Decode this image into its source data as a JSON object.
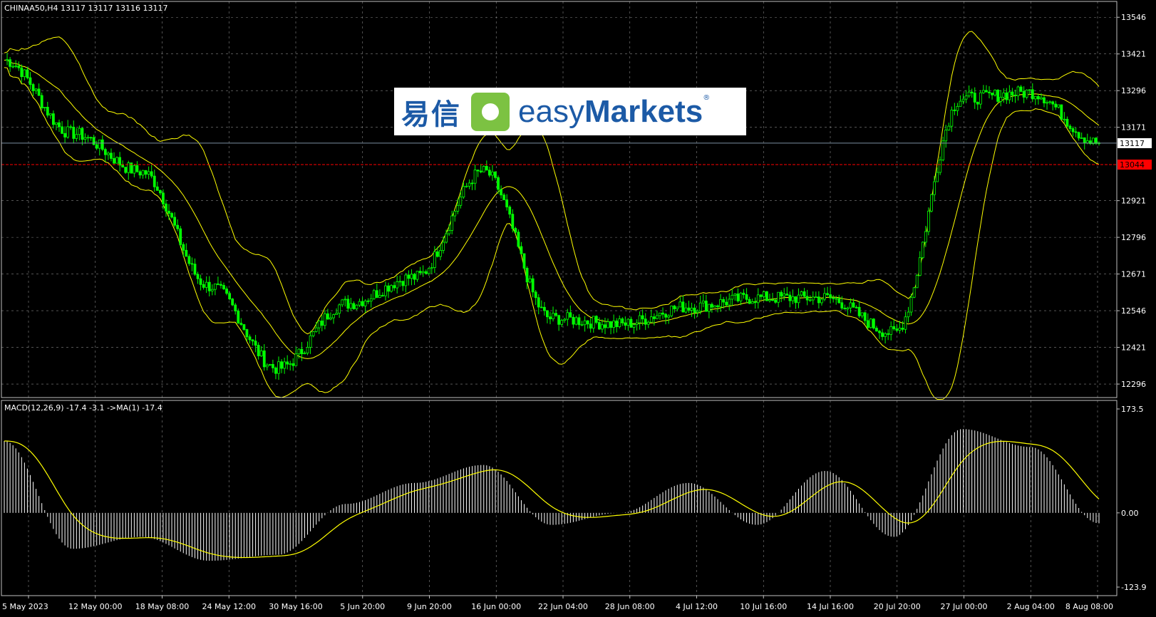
{
  "header": {
    "symbol_line": "CHINAA50,H4  13117 13117 13116 13117"
  },
  "macd_header": {
    "label": "MACD(12,26,9) -17.4 -3.1   ->MA(1) -17.4"
  },
  "watermark": {
    "cn": "易信",
    "en_light": "easy",
    "en_bold": "Markets",
    "reg": "®"
  },
  "price_axis": {
    "ticks": [
      "13546",
      "13421",
      "13296",
      "13171",
      "12921",
      "12796",
      "12671",
      "12546",
      "12421",
      "12296"
    ],
    "current_price": "13117",
    "red_line_price": "13044"
  },
  "macd_axis": {
    "ticks": [
      "173.5",
      "0.00",
      "-123.9"
    ]
  },
  "time_axis": {
    "labels": [
      "5 May 2023",
      "12 May 00:00",
      "18 May 08:00",
      "24 May 12:00",
      "30 May 16:00",
      "5 Jun 20:00",
      "9 Jun 20:00",
      "16 Jun 00:00",
      "22 Jun 04:00",
      "28 Jun 08:00",
      "4 Jul 12:00",
      "10 Jul 16:00",
      "14 Jul 16:00",
      "20 Jul 20:00",
      "27 Jul 00:00",
      "2 Aug 04:00",
      "8 Aug 08:00"
    ]
  },
  "colors": {
    "background": "#000000",
    "candles": "#00ff00",
    "bands": "#ffff00",
    "red_line": "#ff0000",
    "histogram": "#ffffff",
    "signal": "#ffff00",
    "grid": "#c0c0c0"
  },
  "chart_data": {
    "type": "line",
    "symbol": "CHINAA50",
    "timeframe": "H4",
    "indicators": [
      "Bollinger Bands",
      "MACD(12,26,9)"
    ],
    "x_labels": [
      "5 May 2023",
      "12 May 00:00",
      "18 May 08:00",
      "24 May 12:00",
      "30 May 16:00",
      "5 Jun 20:00",
      "9 Jun 20:00",
      "16 Jun 00:00",
      "22 Jun 04:00",
      "28 Jun 08:00",
      "4 Jul 12:00",
      "10 Jul 16:00",
      "14 Jul 16:00",
      "20 Jul 20:00",
      "27 Jul 00:00",
      "2 Aug 04:00",
      "8 Aug 08:00"
    ],
    "close_at_labels": [
      13400,
      13150,
      13020,
      12630,
      12350,
      12570,
      12660,
      13020,
      12520,
      12500,
      12560,
      12590,
      12590,
      12470,
      13270,
      13290,
      13117
    ],
    "price_ylim": [
      12250,
      13600
    ],
    "macd_at_labels": [
      120,
      -60,
      -40,
      -80,
      -70,
      15,
      50,
      80,
      -20,
      0,
      50,
      -20,
      70,
      -40,
      140,
      110,
      -17.4
    ],
    "macd_ylim": [
      -123.9,
      173.5
    ],
    "current_price": 13117,
    "marked_price": 13044,
    "macd_value": -17.4,
    "signal_value": -3.1
  }
}
